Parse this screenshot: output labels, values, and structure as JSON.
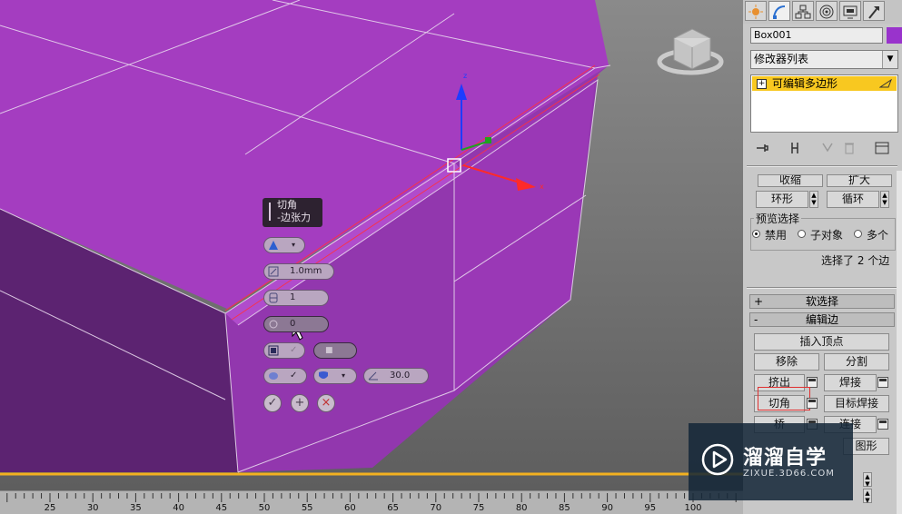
{
  "viewport": {
    "gizmo_labels": {
      "z": "z",
      "x": "x"
    }
  },
  "caddy": {
    "title_line1": "切角",
    "title_line2": "-边张力",
    "amount": "1.0mm",
    "segments": "1",
    "tension": "0",
    "angle": "30.0"
  },
  "panel": {
    "object_name": "Box001",
    "object_color": "#9933cc",
    "modifier_list": "修改器列表",
    "stack": {
      "item": "可编辑多边形"
    },
    "selection": {
      "shrink": "收缩",
      "grow": "扩大",
      "ring": "环形",
      "loop": "循环",
      "preview_label": "预览选择",
      "preview_options": [
        "禁用",
        "子对象",
        "多个"
      ],
      "preview_selected": "禁用",
      "status": "选择了 2 个边"
    },
    "soft_selection": {
      "sign": "+",
      "title": "软选择"
    },
    "edit_edges": {
      "sign": "-",
      "title": "编辑边",
      "insert_vertex": "插入顶点",
      "remove": "移除",
      "split": "分割",
      "extrude": "挤出",
      "weld": "焊接",
      "chamfer": "切角",
      "target_weld": "目标焊接",
      "bridge": "桥",
      "connect": "连接",
      "create_shape": "图形"
    }
  },
  "timeline": {
    "ticks": [
      25,
      30,
      35,
      40,
      45,
      50,
      55,
      60,
      65,
      70,
      75,
      80,
      85,
      90,
      95,
      100
    ]
  },
  "watermark": {
    "name": "溜溜自学",
    "url": "ZIXUE.3D66.COM"
  }
}
